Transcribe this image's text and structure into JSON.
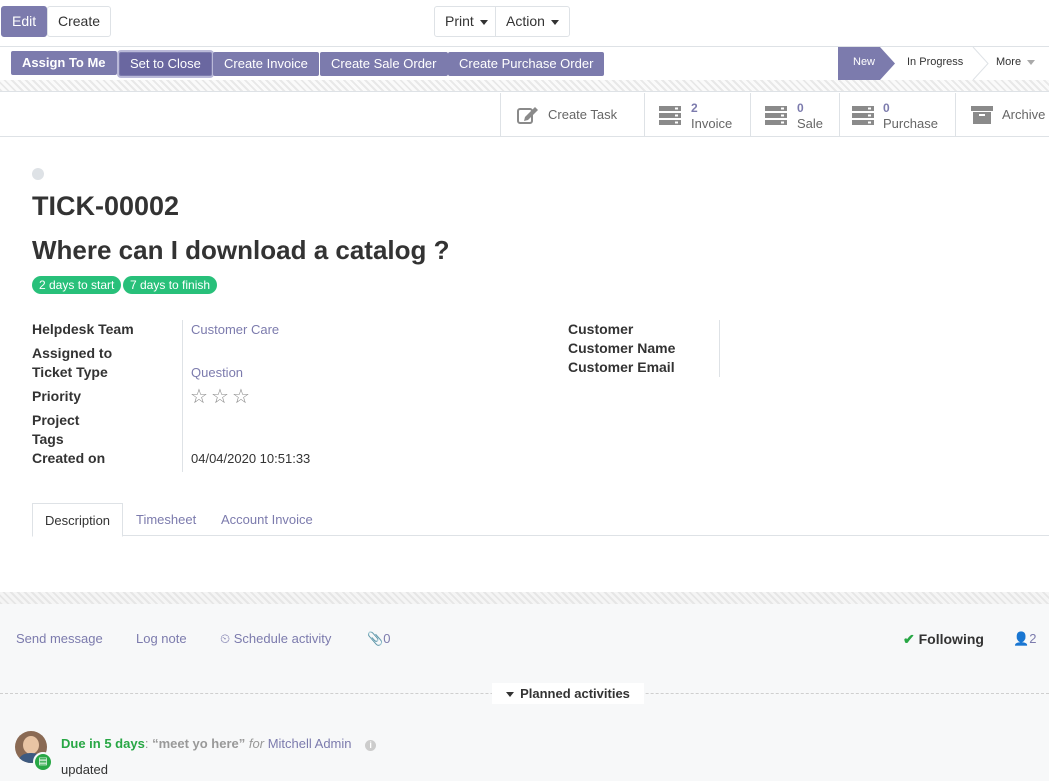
{
  "control_panel": {
    "edit_label": "Edit",
    "create_label": "Create",
    "print_label": "Print",
    "action_label": "Action"
  },
  "statusbar": {
    "buttons": [
      {
        "label": "Assign To Me"
      },
      {
        "label": "Set to Close"
      },
      {
        "label": "Create Invoice"
      },
      {
        "label": "Create Sale Order"
      },
      {
        "label": "Create Purchase Order"
      }
    ],
    "stages": {
      "active": "New",
      "next": "In Progress",
      "more": "More"
    }
  },
  "smart_buttons": {
    "create_task": "Create Task",
    "invoice": {
      "count": "2",
      "label": "Invoice"
    },
    "sale": {
      "count": "0",
      "label": "Sale"
    },
    "purchase": {
      "count": "0",
      "label": "Purchase"
    },
    "archive": "Archive"
  },
  "ticket": {
    "reference": "TICK-00002",
    "title": "Where can I download a catalog ?",
    "sla_badges": [
      "2 days to start",
      "7 days to finish"
    ],
    "left_fields": [
      {
        "label": "Helpdesk Team",
        "value": "Customer Care"
      },
      {
        "label": "Assigned to",
        "value": ""
      },
      {
        "label": "Ticket Type",
        "value": "Question"
      },
      {
        "label": "Priority",
        "value": ""
      },
      {
        "label": "Project",
        "value": ""
      },
      {
        "label": "Tags",
        "value": ""
      },
      {
        "label": "Created on",
        "value": "04/04/2020 10:51:33"
      }
    ],
    "priority_stars": 3,
    "priority_value": 0,
    "right_fields": [
      {
        "label": "Customer"
      },
      {
        "label": "Customer Name"
      },
      {
        "label": "Customer Email"
      }
    ]
  },
  "tabs": [
    "Description",
    "Timesheet",
    "Account Invoice"
  ],
  "chatter": {
    "send_message": "Send message",
    "log_note": "Log note",
    "schedule_activity": "Schedule activity",
    "attachments": "0",
    "following": "Following",
    "followers": "2",
    "planned_activities": "Planned activities",
    "activity": {
      "due": "Due in 5 days",
      "summary": "“meet yo here”",
      "for_word": "for",
      "user": "Mitchell Admin",
      "note": "updated"
    }
  },
  "colors": {
    "brand": "#7c7bad",
    "success": "#28c07a"
  }
}
